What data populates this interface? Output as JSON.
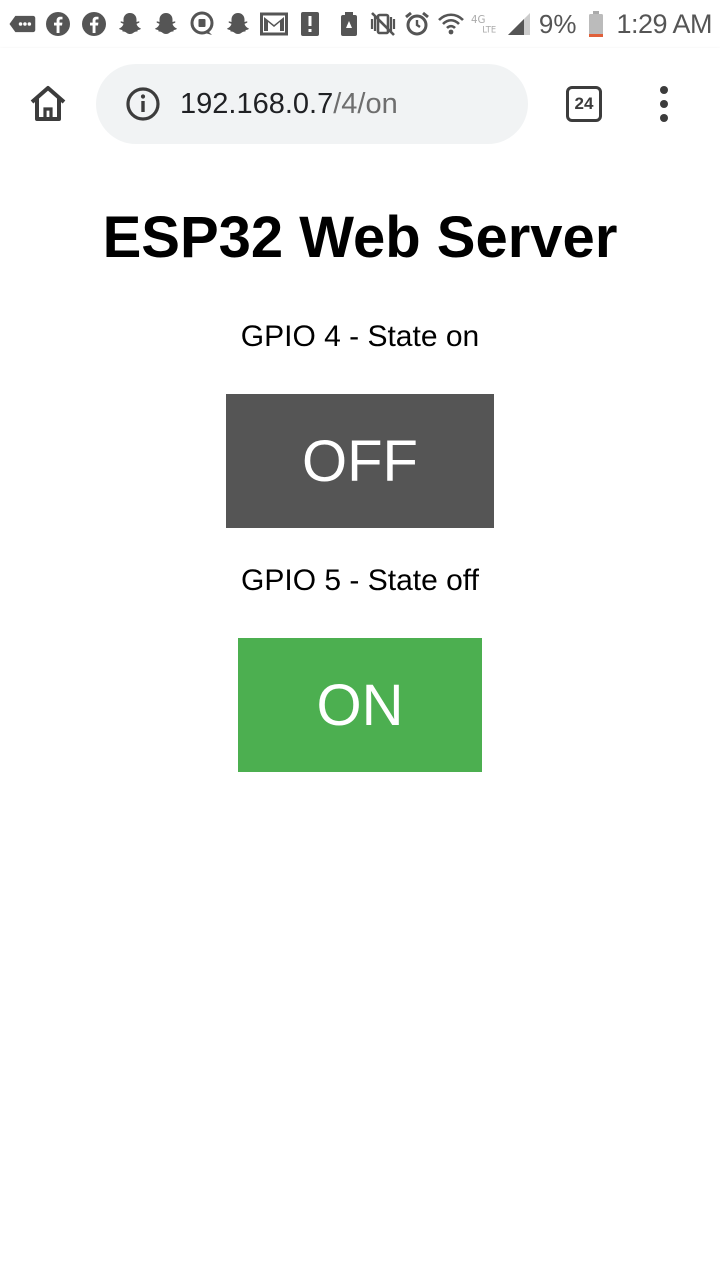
{
  "status_bar": {
    "notification_icons": [
      "messages-icon",
      "facebook-icon",
      "facebook-icon",
      "snapchat-icon",
      "snapchat-icon",
      "chat-bubble-icon",
      "snapchat-icon",
      "gmail-icon",
      "alert-icon"
    ],
    "battery_percent": "9%",
    "time": "1:29 AM"
  },
  "browser": {
    "url_host": "192.168.0.7",
    "url_path": "/4/on",
    "tab_count": "24"
  },
  "page": {
    "title": "ESP32 Web Server",
    "gpios": [
      {
        "label": "GPIO 4 - State on",
        "button_label": "OFF",
        "button_color": "#555555"
      },
      {
        "label": "GPIO 5 - State off",
        "button_label": "ON",
        "button_color": "#4caf50"
      }
    ]
  }
}
